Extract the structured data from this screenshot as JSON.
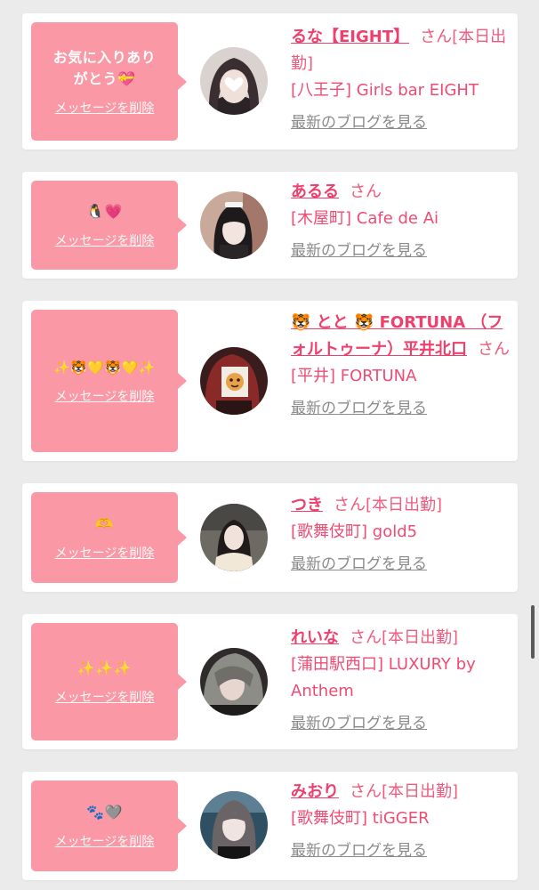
{
  "delete_label": "メッセージを削除",
  "blog_label": "最新のブログを見る",
  "colors": {
    "bubble": "#fb98a5",
    "name": "#ee3f6d",
    "page_bg": "#ebebeb"
  },
  "cards": [
    {
      "message": "お気に入りありがとう💝",
      "name": "るな【EIGHT】",
      "san": "さん",
      "tag": "[本日出勤]",
      "shop": "[八王子] Girls bar EIGHT"
    },
    {
      "message": "🐧💗",
      "name": "あるる",
      "san": "さん",
      "tag": "",
      "shop": "[木屋町] Cafe de Ai"
    },
    {
      "message": "✨🐯💛🐯💛✨",
      "name": "🐯 とと 🐯 FORTUNA （フォルトゥーナ）平井北口",
      "san": "さん",
      "tag": "",
      "shop": "[平井] FORTUNA"
    },
    {
      "message": "🫶",
      "name": "つき",
      "san": "さん",
      "tag": "[本日出勤]",
      "shop": "[歌舞伎町] gold5"
    },
    {
      "message": "✨✨✨",
      "name": "れいな",
      "san": "さん",
      "tag": "[本日出勤]",
      "shop": "[蒲田駅西口] LUXURY by Anthem"
    },
    {
      "message": "🐾🩶",
      "name": "みおり",
      "san": "さん",
      "tag": "[本日出勤]",
      "shop": "[歌舞伎町] tiGGER"
    }
  ]
}
